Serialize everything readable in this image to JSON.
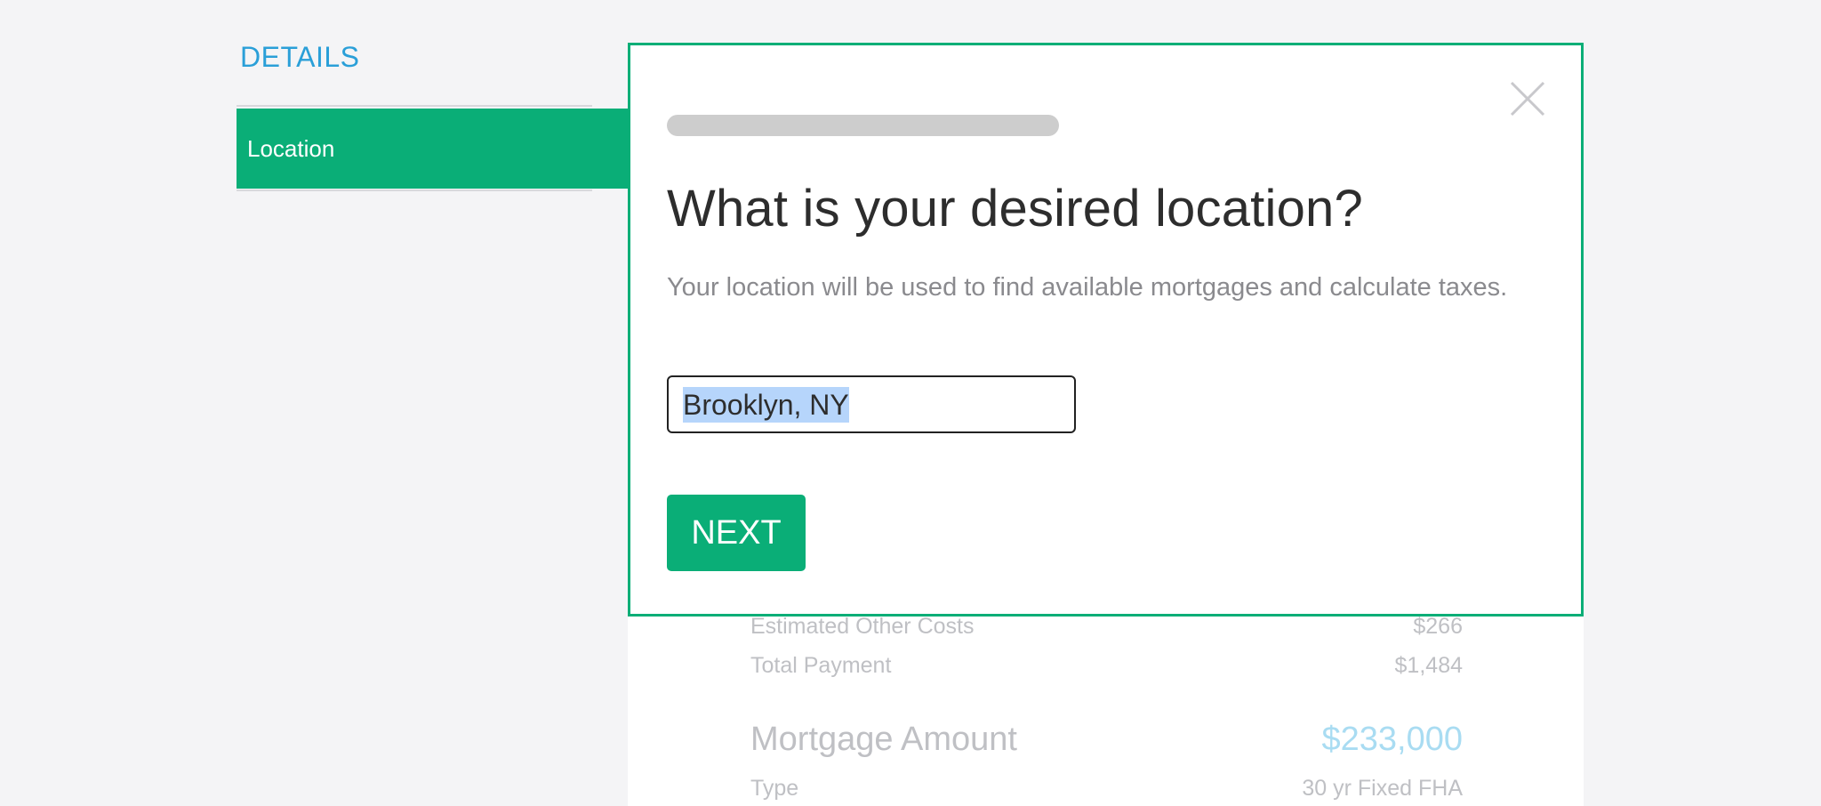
{
  "sidebar": {
    "title": "DETAILS",
    "items": [
      {
        "label": "Location",
        "active": true
      }
    ]
  },
  "modal": {
    "title": "What is your desired location?",
    "description": "Your location will be used to find available mortgages and calculate taxes.",
    "location_input": {
      "value": "Brooklyn, NY",
      "selected": true
    },
    "next_label": "NEXT",
    "close_icon": "close-icon"
  },
  "summary": {
    "rows": [
      {
        "label": "Estimated Other Costs",
        "value": "$266"
      },
      {
        "label": "Total Payment",
        "value": "$1,484"
      }
    ],
    "mortgage": {
      "label": "Mortgage Amount",
      "value": "$233,000"
    },
    "type": {
      "label": "Type",
      "value": "30 yr Fixed FHA"
    }
  },
  "colors": {
    "accent_green": "#0aae77",
    "accent_blue": "#2a9fd8",
    "selection": "#b6d5fb"
  }
}
